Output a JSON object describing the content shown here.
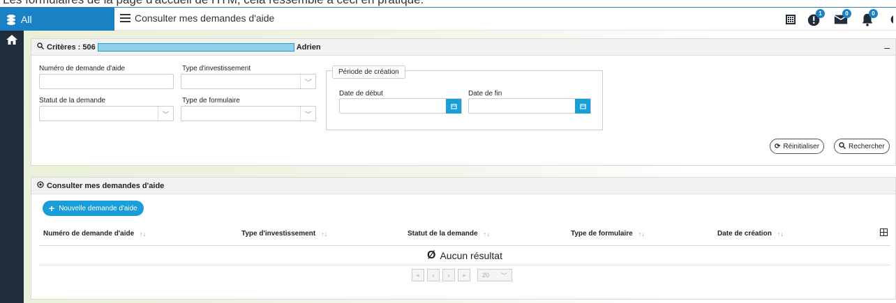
{
  "caption": "Les formulaires de la page d'accueil de HTM, cela ressemble à ceci en pratique.",
  "topbar": {
    "app_switch_label": "All",
    "menu_title": "Consulter mes demandes d'aide",
    "badges": {
      "alerts": "1",
      "messages": "0",
      "notifications": "0"
    }
  },
  "criteria": {
    "title_prefix": "Critères : 506",
    "title_suffix": "Adrien",
    "collapse": "–",
    "fields": {
      "numero_label": "Numéro de demande d'aide",
      "type_invest_label": "Type d'investissement",
      "statut_label": "Statut de la demande",
      "type_form_label": "Type de formulaire"
    },
    "periode": {
      "legend": "Période de création",
      "date_debut_label": "Date de début",
      "date_fin_label": "Date de fin"
    },
    "reset_label": "Réinitialiser",
    "search_label": "Rechercher"
  },
  "results": {
    "title": "Consulter mes demandes d'aide",
    "new_button": "Nouvelle demande d'aide",
    "columns": [
      "Numéro de demande d'aide",
      "Type d'investissement",
      "Statut de la demande",
      "Type de formulaire",
      "Date de création"
    ],
    "empty_text": "Aucun résultat",
    "empty_symbol": "Ø",
    "pager": {
      "first": "«",
      "prev": "‹",
      "next": "›",
      "last": "»",
      "page_size": "20"
    }
  },
  "colors": {
    "primary": "#1a81c5",
    "accent": "#1a9ed8",
    "rail": "#1f2d3d"
  }
}
